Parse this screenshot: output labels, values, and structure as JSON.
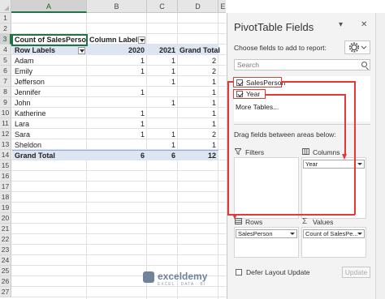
{
  "sheet": {
    "columns": [
      "A",
      "B",
      "C",
      "D",
      "E"
    ],
    "rows": [
      "1",
      "2",
      "3",
      "4",
      "5",
      "6",
      "7",
      "8",
      "9",
      "10",
      "11",
      "12",
      "13",
      "14",
      "15",
      "16",
      "17",
      "18",
      "19",
      "20",
      "21",
      "22",
      "23",
      "24",
      "25",
      "26",
      "27"
    ],
    "selected_column": "A",
    "selected_row": "3"
  },
  "pivot": {
    "values_caption": "Count of SalesPerson",
    "column_labels": "Column Labels",
    "row_labels": "Row Labels",
    "years": [
      "2020",
      "2021"
    ],
    "grand_total_header": "Grand Total",
    "rows": [
      {
        "name": "Adam",
        "y2020": "1",
        "y2021": "1",
        "total": "2"
      },
      {
        "name": "Emily",
        "y2020": "1",
        "y2021": "1",
        "total": "2"
      },
      {
        "name": "Jefferson",
        "y2020": "",
        "y2021": "1",
        "total": "1"
      },
      {
        "name": "Jennifer",
        "y2020": "1",
        "y2021": "",
        "total": "1"
      },
      {
        "name": "John",
        "y2020": "",
        "y2021": "1",
        "total": "1"
      },
      {
        "name": "Katherine",
        "y2020": "1",
        "y2021": "",
        "total": "1"
      },
      {
        "name": "Lara",
        "y2020": "1",
        "y2021": "",
        "total": "1"
      },
      {
        "name": "Sara",
        "y2020": "1",
        "y2021": "1",
        "total": "2"
      },
      {
        "name": "Sheldon",
        "y2020": "",
        "y2021": "1",
        "total": "1"
      }
    ],
    "grand_total": {
      "label": "Grand Total",
      "y2020": "6",
      "y2021": "6",
      "total": "12"
    }
  },
  "pane": {
    "title": "PivotTable Fields",
    "dropdown_glyph": "▾",
    "close_glyph": "✕",
    "choose_label": "Choose fields to add to report:",
    "search_placeholder": "Search",
    "fields": [
      {
        "label": "SalesPerson",
        "checked": true
      },
      {
        "label": "Year",
        "checked": true
      }
    ],
    "more_tables": "More Tables...",
    "drag_label": "Drag fields between areas below:",
    "areas": {
      "filters": {
        "label": "Filters",
        "icon": "filter-icon"
      },
      "columns": {
        "label": "Columns",
        "icon": "columns-icon",
        "chip": "Year"
      },
      "rows": {
        "label": "Rows",
        "icon": "rows-icon",
        "chip": "SalesPerson"
      },
      "values": {
        "label": "Values",
        "icon": "sigma-icon",
        "chip": "Count of SalesPe..."
      }
    },
    "defer_label": "Defer Layout Update",
    "update_label": "Update",
    "annotation_color": "#e53935"
  },
  "watermark": {
    "name": "exceldemy",
    "tagline": "EXCEL · DATA · BI"
  }
}
